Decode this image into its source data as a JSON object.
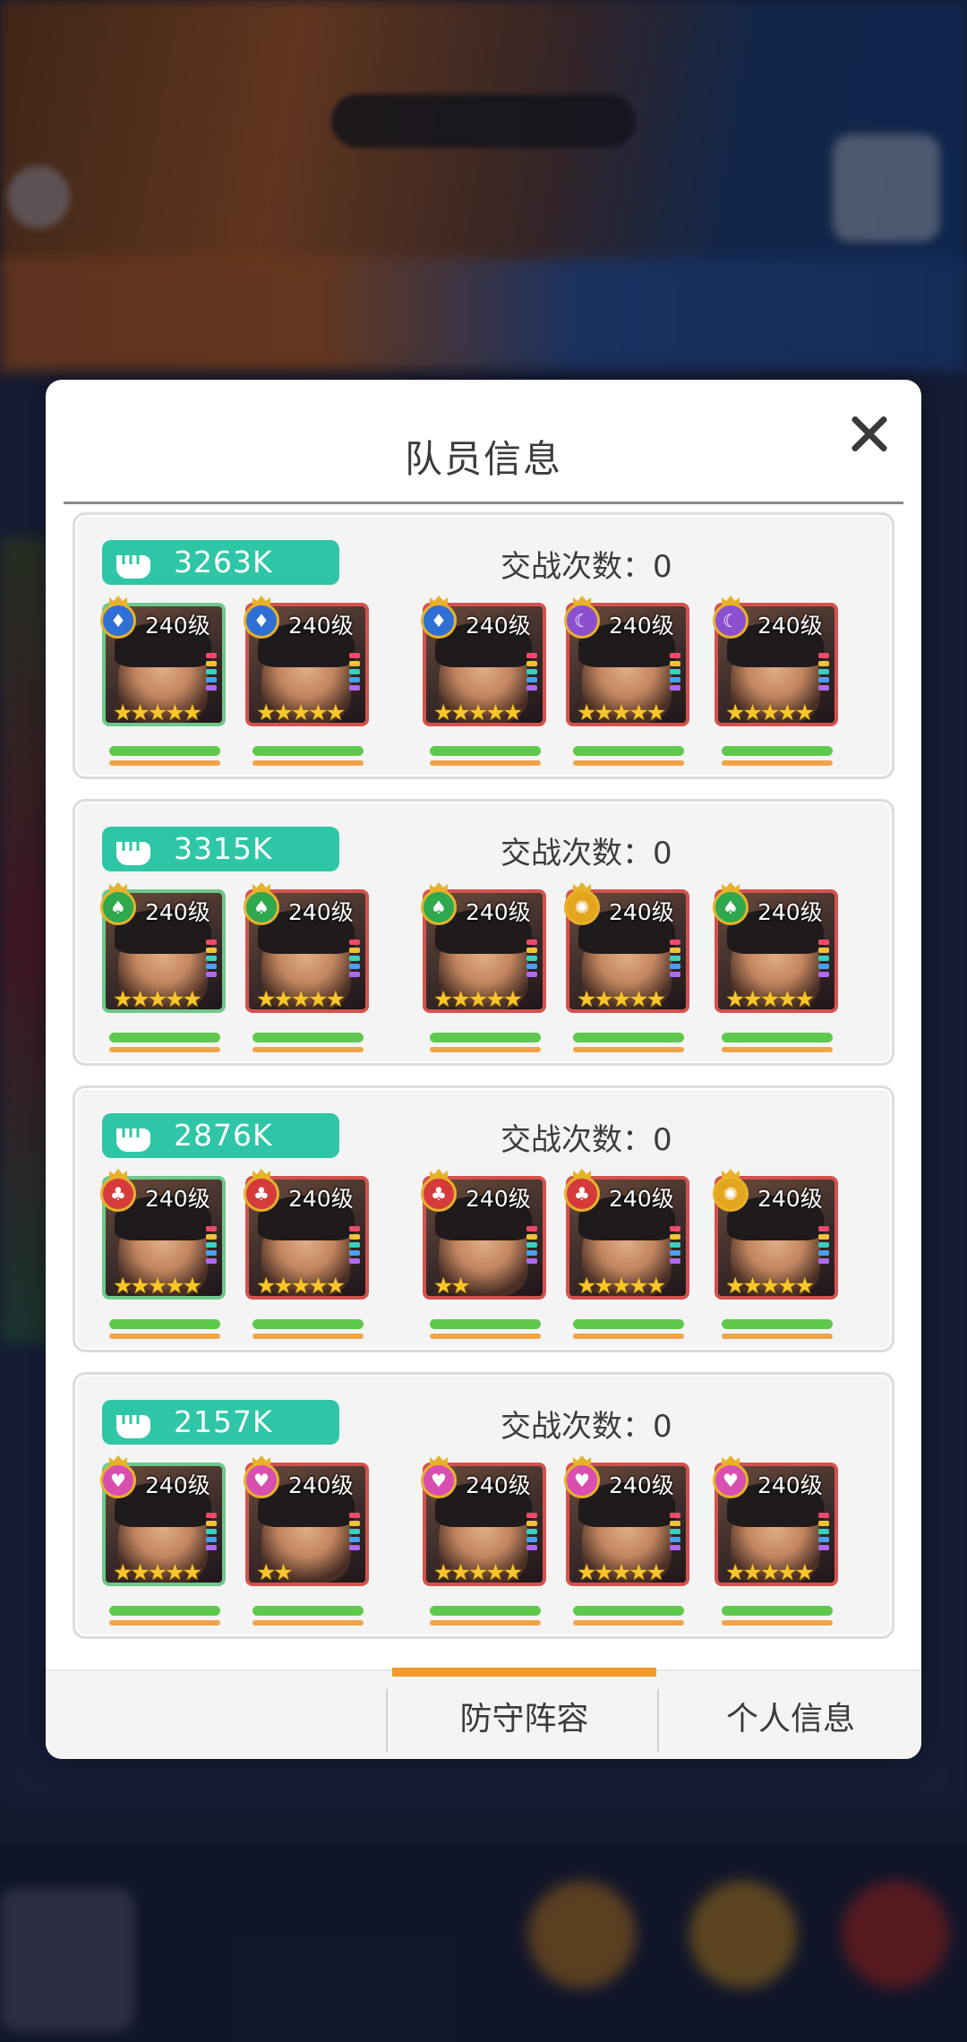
{
  "dialog": {
    "title": "队员信息"
  },
  "teams": [
    {
      "power": "3263K",
      "battles": "交战次数：0",
      "heroes": [
        {
          "level": "240级",
          "stars": 5,
          "faction": "blue",
          "frame": "green"
        },
        {
          "level": "240级",
          "stars": 5,
          "faction": "blue",
          "frame": "red"
        },
        {
          "level": "240级",
          "stars": 5,
          "faction": "blue",
          "frame": "red"
        },
        {
          "level": "240级",
          "stars": 5,
          "faction": "purple",
          "frame": "red"
        },
        {
          "level": "240级",
          "stars": 5,
          "faction": "purple",
          "frame": "red"
        }
      ]
    },
    {
      "power": "3315K",
      "battles": "交战次数：0",
      "heroes": [
        {
          "level": "240级",
          "stars": 5,
          "faction": "green",
          "frame": "green"
        },
        {
          "level": "240级",
          "stars": 5,
          "faction": "green",
          "frame": "red"
        },
        {
          "level": "240级",
          "stars": 5,
          "faction": "green",
          "frame": "red"
        },
        {
          "level": "240级",
          "stars": 5,
          "faction": "gold",
          "frame": "red"
        },
        {
          "level": "240级",
          "stars": 5,
          "faction": "green",
          "frame": "red"
        }
      ]
    },
    {
      "power": "2876K",
      "battles": "交战次数：0",
      "heroes": [
        {
          "level": "240级",
          "stars": 5,
          "faction": "red",
          "frame": "green"
        },
        {
          "level": "240级",
          "stars": 5,
          "faction": "red",
          "frame": "red"
        },
        {
          "level": "240级",
          "stars": 2,
          "faction": "red",
          "frame": "red"
        },
        {
          "level": "240级",
          "stars": 5,
          "faction": "red",
          "frame": "red"
        },
        {
          "level": "240级",
          "stars": 5,
          "faction": "gold",
          "frame": "red"
        }
      ]
    },
    {
      "power": "2157K",
      "battles": "交战次数：0",
      "heroes": [
        {
          "level": "240级",
          "stars": 5,
          "faction": "pink",
          "frame": "green"
        },
        {
          "level": "240级",
          "stars": 2,
          "faction": "pink",
          "frame": "red"
        },
        {
          "level": "240级",
          "stars": 5,
          "faction": "pink",
          "frame": "red"
        },
        {
          "level": "240级",
          "stars": 5,
          "faction": "pink",
          "frame": "red"
        },
        {
          "level": "240级",
          "stars": 5,
          "faction": "pink",
          "frame": "red"
        }
      ]
    }
  ],
  "tabs": [
    {
      "label": "",
      "active": false
    },
    {
      "label": "防守阵容",
      "active": true
    },
    {
      "label": "个人信息",
      "active": false
    }
  ],
  "colors": {
    "power_badge": "#2ec6a6",
    "hp_bar": "#5ec94c",
    "mp_bar": "#f0a448",
    "tab_active": "#f29b2a",
    "faction_blue": "#2f6fd6",
    "faction_purple": "#8b4fd0",
    "faction_green": "#2fa84e",
    "faction_gold": "#e3a51e",
    "faction_red": "#d53b3b",
    "faction_pink": "#d94fb1"
  }
}
